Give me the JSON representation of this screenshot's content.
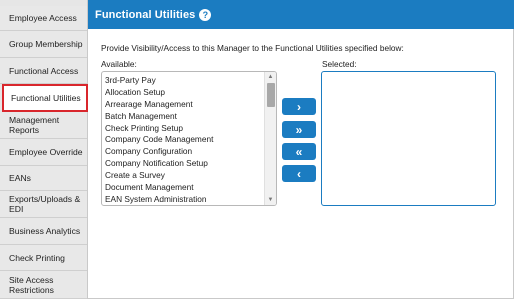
{
  "sidebar": {
    "items": [
      {
        "label": "Employee Access",
        "active": false
      },
      {
        "label": "Group Membership",
        "active": false
      },
      {
        "label": "Functional Access",
        "active": false
      },
      {
        "label": "Functional Utilities",
        "active": true
      },
      {
        "label": "Management Reports",
        "active": false
      },
      {
        "label": "Employee Override",
        "active": false
      },
      {
        "label": "EANs",
        "active": false
      },
      {
        "label": "Exports/Uploads & EDI",
        "active": false
      },
      {
        "label": "Business Analytics",
        "active": false
      },
      {
        "label": "Check Printing",
        "active": false
      },
      {
        "label": "Site Access Restrictions",
        "active": false
      }
    ]
  },
  "header": {
    "title": "Functional Utilities",
    "help_icon": "?"
  },
  "main": {
    "instructions": "Provide Visibility/Access to this Manager to the Functional Utilities specified below:",
    "available_label": "Available:",
    "selected_label": "Selected:",
    "available_items": [
      "3rd-Party Pay",
      "Allocation Setup",
      "Arrearage Management",
      "Batch Management",
      "Check Printing Setup",
      "Company Code Management",
      "Company Configuration",
      "Company Notification Setup",
      "Create a Survey",
      "Document Management",
      "EAN System Administration"
    ],
    "selected_items": [],
    "buttons": {
      "move_right": "›",
      "move_all_right": "»",
      "move_all_left": "«",
      "move_left": "‹"
    },
    "scroll_up": "▲",
    "scroll_down": "▼"
  },
  "colors": {
    "accent": "#1b7cc1",
    "active_outline": "#d9262c",
    "sidebar_bg": "#e8e8e8"
  }
}
